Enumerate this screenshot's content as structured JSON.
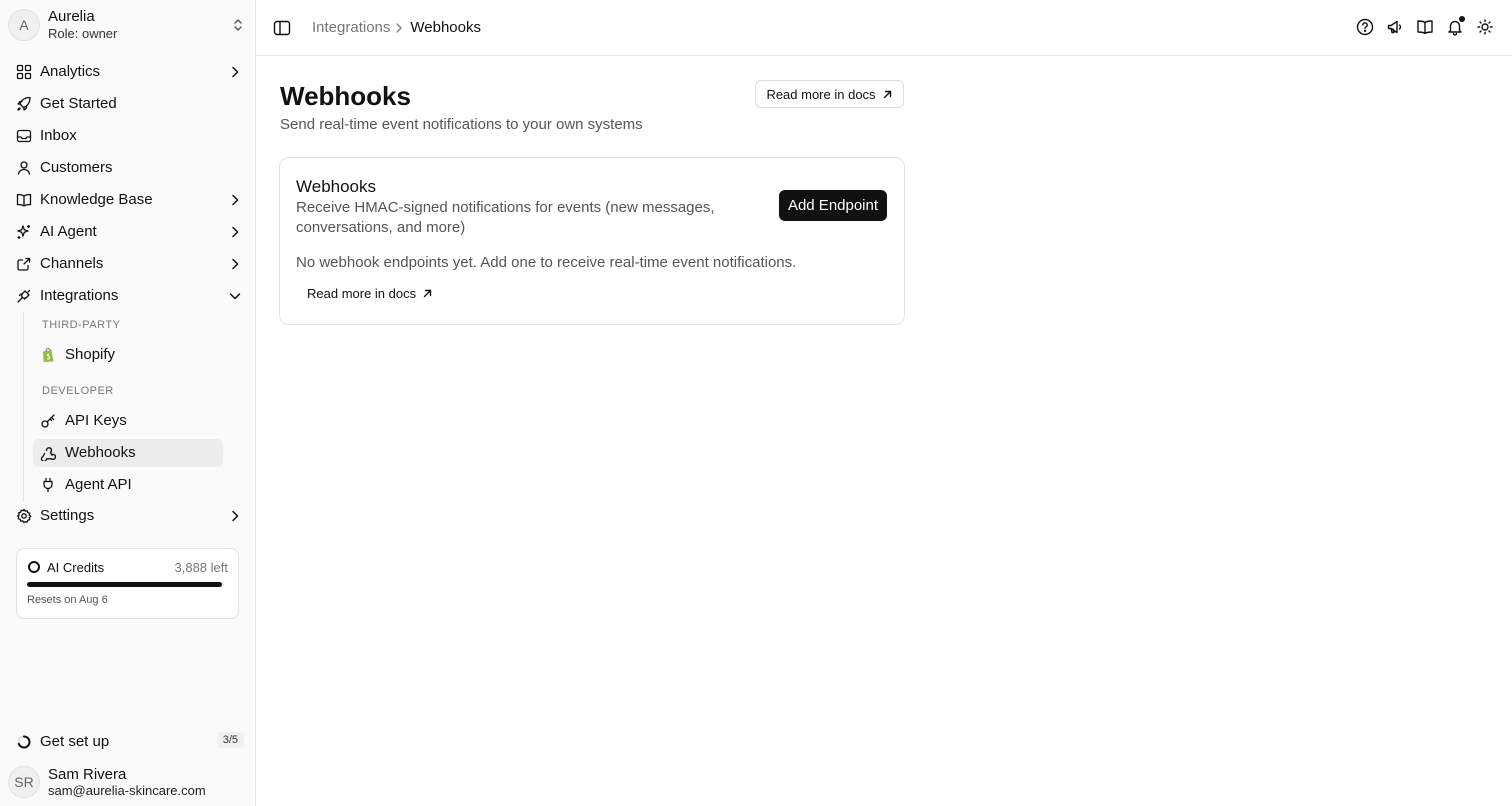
{
  "workspace": {
    "initial": "A",
    "name": "Aurelia",
    "role": "Role: owner"
  },
  "nav": {
    "analytics": "Analytics",
    "get_started": "Get Started",
    "inbox": "Inbox",
    "customers": "Customers",
    "knowledge_base": "Knowledge Base",
    "ai_agent": "AI Agent",
    "channels": "Channels",
    "integrations": "Integrations",
    "settings": "Settings"
  },
  "integrations_sub": {
    "third_party_label": "THIRD-PARTY",
    "shopify": "Shopify",
    "developer_label": "DEVELOPER",
    "api_keys": "API Keys",
    "webhooks": "Webhooks",
    "agent_api": "Agent API"
  },
  "credits": {
    "title": "AI Credits",
    "left": "3,888 left",
    "progress_fraction": 0.99,
    "reset": "Resets on Aug 6"
  },
  "setup": {
    "label": "Get set up",
    "count": "3/5"
  },
  "user": {
    "initials": "SR",
    "name": "Sam Rivera",
    "email": "sam@aurelia-skincare.com"
  },
  "breadcrumb": {
    "parent": "Integrations",
    "current": "Webhooks"
  },
  "page": {
    "title": "Webhooks",
    "subtitle": "Send real-time event notifications to your own systems",
    "docs_button": "Read more in docs"
  },
  "card": {
    "title": "Webhooks",
    "description": "Receive HMAC-signed notifications for events (new messages, conversations, and more)",
    "add_button": "Add Endpoint",
    "empty_text": "No webhook endpoints yet. Add one to receive real-time event notifications.",
    "docs_link": "Read more in docs"
  },
  "colors": {
    "accent": "#111111",
    "active_bg": "#ececec",
    "shopify_green": "#95bf47"
  }
}
